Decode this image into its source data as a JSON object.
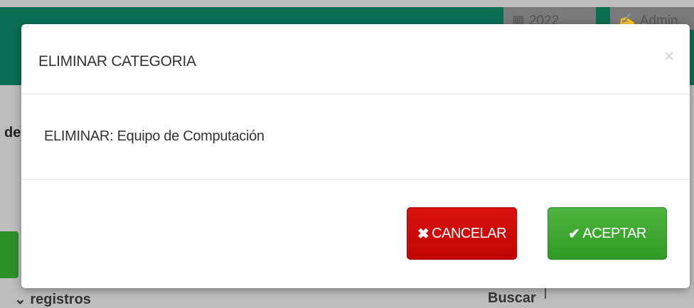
{
  "background": {
    "year_chip": "2022",
    "user_chip": "Admin",
    "left_fragment": "de",
    "bottom_left_fragment": "registros",
    "bottom_right_fragment": "Buscar"
  },
  "modal": {
    "title": "ELIMINAR CATEGORIA",
    "close_symbol": "×",
    "message": "ELIMINAR: Equipo de Computación",
    "buttons": {
      "cancel": {
        "icon": "close-icon",
        "label": "CANCELAR",
        "color": "#c9100d"
      },
      "accept": {
        "icon": "check-icon",
        "label": "ACEPTAR",
        "color": "#3aa52f"
      }
    }
  },
  "colors": {
    "topbar": "#0a6e53",
    "overlay": "#bdbdbd"
  }
}
